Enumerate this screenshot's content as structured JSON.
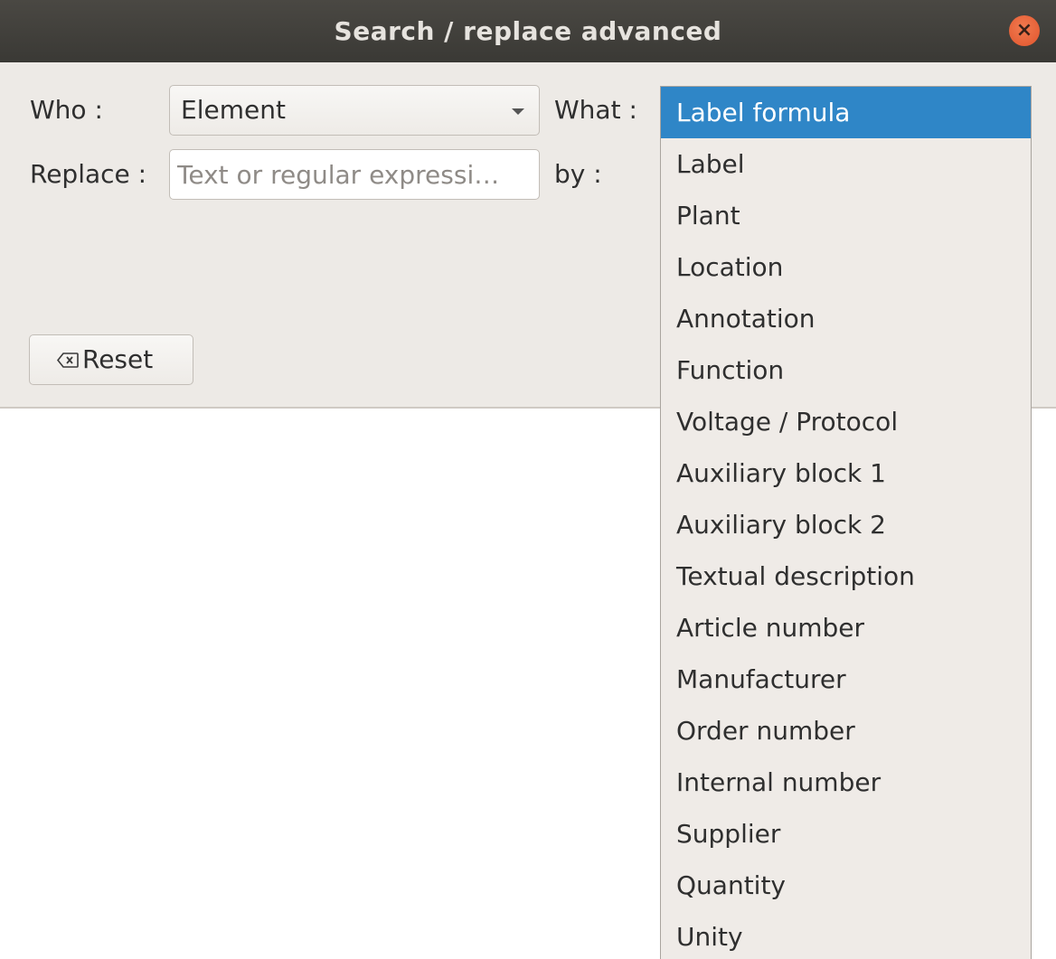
{
  "window": {
    "title": "Search / replace advanced",
    "close_symbol": "×"
  },
  "form": {
    "who_label": "Who :",
    "who_value": "Element",
    "what_label": "What :",
    "replace_label": "Replace :",
    "replace_placeholder": "Text or regular expressi…",
    "by_label": "by :",
    "reset_label": "Reset"
  },
  "what_dropdown": {
    "selected": "Label formula",
    "items": [
      "Label formula",
      "Label",
      "Plant",
      "Location",
      "Annotation",
      "Function",
      "Voltage / Protocol",
      "Auxiliary block 1",
      "Auxiliary block 2",
      "Textual description",
      "Article number",
      "Manufacturer",
      "Order number",
      "Internal number",
      "Supplier",
      "Quantity",
      "Unity"
    ]
  },
  "icons": {
    "close": "close-icon",
    "combo_arrow": "chevron-down-icon",
    "reset": "backspace-clear-icon"
  },
  "colors": {
    "titlebar": "#3f3d39",
    "close_button": "#e8603a",
    "dialog_bg": "#edeae6",
    "selection": "#2f86c7"
  }
}
